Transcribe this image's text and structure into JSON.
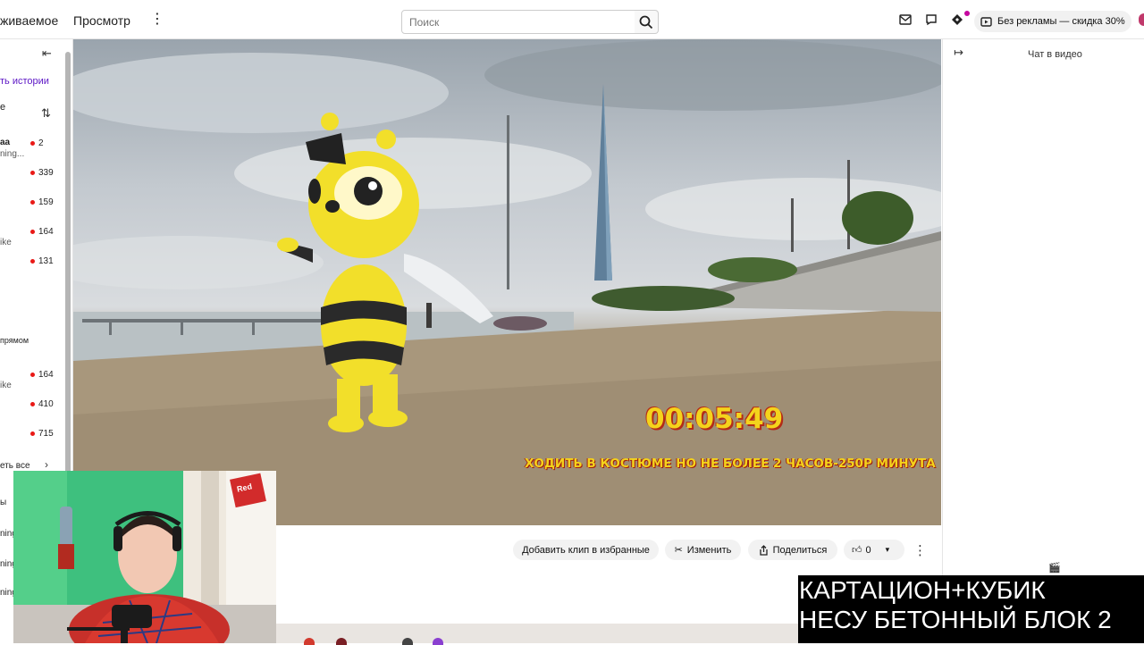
{
  "topbar": {
    "nav_partial": "живаемое",
    "nav_browse": "Просмотр",
    "search_placeholder": "Поиск",
    "promo_label": "Без рекламы — скидка 30%"
  },
  "sidebar": {
    "history_link": "ть истории",
    "section_letter": "е",
    "channels": [
      {
        "name": "аа",
        "sub": "ning...",
        "count": "2"
      },
      {
        "name": "",
        "sub": "",
        "count": "339"
      },
      {
        "name": "",
        "sub": "",
        "count": "159"
      },
      {
        "name": "",
        "sub": "ike",
        "count": "164"
      },
      {
        "name": "",
        "sub": "",
        "count": "131"
      }
    ],
    "live_label": "прямом",
    "live_channels": [
      {
        "sub": "ike",
        "count": "164"
      },
      {
        "sub": "",
        "count": "410"
      },
      {
        "sub": "",
        "count": "715"
      }
    ],
    "show_all": "еть все",
    "tail_labels": [
      "ы",
      "ning",
      "ning",
      "ning"
    ]
  },
  "video": {
    "timer": "00:05:49",
    "overlay": "ХОДИТЬ В КОСТЮМЕ НО НЕ БОЛЕЕ 2 ЧАСОВ-250Р МИНУТА"
  },
  "chat": {
    "title": "Чат в видео"
  },
  "actions": {
    "add_clip": "Добавить клип в избранные",
    "edit": "Изменить",
    "share": "Поделиться",
    "likes": "0"
  },
  "webcam": {
    "sign_text": "Red"
  },
  "caption": {
    "line1": "КАРТАЦИОН+КУБИК",
    "line2": "НЕСУ БЕТОННЫЙ БЛОК 2"
  },
  "colors": {
    "live_dot": "#e91916",
    "overlay_yellow": "#f4d31c",
    "overlay_shadow": "#b32b17"
  },
  "icons": [
    "kebab-icon",
    "search-icon",
    "inbox-icon",
    "chat-bubble-icon",
    "prime-icon",
    "ad-free-icon",
    "collapse-left-icon",
    "sort-icon",
    "collapse-right-icon",
    "clip-icon",
    "scissors-icon",
    "share-icon",
    "thumbs-up-icon",
    "chevron-down-icon",
    "more-icon"
  ]
}
